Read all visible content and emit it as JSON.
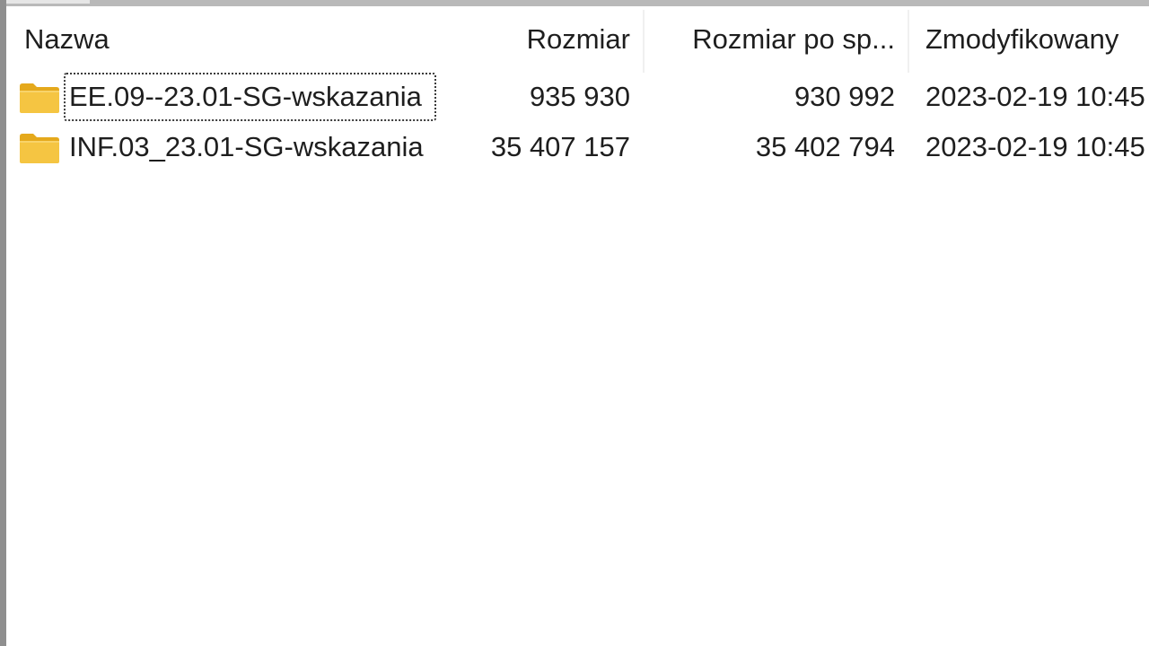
{
  "columns": {
    "name": "Nazwa",
    "size": "Rozmiar",
    "packed_size": "Rozmiar po sp...",
    "modified": "Zmodyfikowany"
  },
  "rows": [
    {
      "icon": "folder-icon",
      "name": "EE.09--23.01-SG-wskazania",
      "size": "935 930",
      "packed_size": "930 992",
      "modified": "2023-02-19 10:45",
      "focused": true
    },
    {
      "icon": "folder-icon",
      "name": "INF.03_23.01-SG-wskazania",
      "size": "35 407 157",
      "packed_size": "35 402 794",
      "modified": "2023-02-19 10:45",
      "focused": false
    }
  ],
  "colors": {
    "folder_body": "#f5c542",
    "folder_tab": "#e5a91c",
    "text": "#1e1e1e",
    "background": "#ffffff"
  }
}
